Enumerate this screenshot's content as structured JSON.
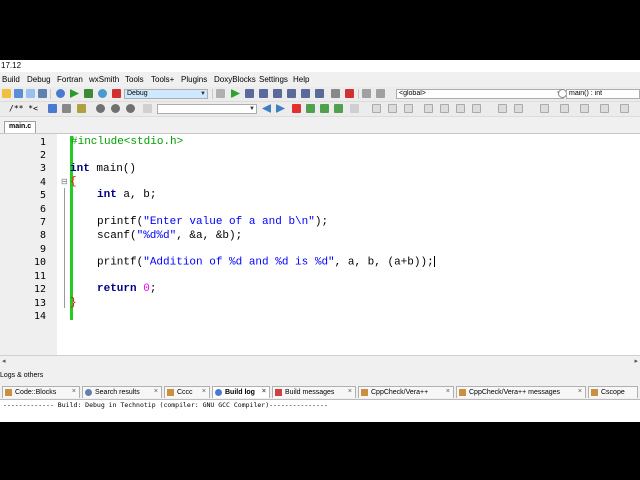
{
  "app": {
    "title_fragment": "17.12"
  },
  "menu": [
    "Build",
    "Debug",
    "Fortran",
    "wxSmith",
    "Tools",
    "Tools+",
    "Plugins",
    "DoxyBlocks",
    "Settings",
    "Help"
  ],
  "toolbar": {
    "build_target": "Debug",
    "scope_select": "<global>",
    "function_select": "main() : int",
    "doxy_comment": "/** *<"
  },
  "editor": {
    "tab_label": "main.c",
    "line_numbers": [
      "1",
      "2",
      "3",
      "4",
      "5",
      "6",
      "7",
      "8",
      "9",
      "10",
      "11",
      "12",
      "13",
      "14"
    ],
    "lines": {
      "l1": "#include<stdio.h>",
      "l3a": "int",
      "l3b": " main()",
      "l4": "{",
      "l5a": "int",
      "l5b": " a, b;",
      "l7a": "printf(",
      "l7b": "\"Enter value of a and b\\n\"",
      "l7c": ");",
      "l8a": "scanf(",
      "l8b": "\"%d%d\"",
      "l8c": ", &a, &b);",
      "l10a": "printf(",
      "l10b": "\"Addition of %d and %d is %d\"",
      "l10c": ", a, b, (a+b));",
      "l12a": "return",
      "l12b": " ",
      "l12c": "0",
      "l12d": ";",
      "l13": "}"
    }
  },
  "logs": {
    "title": "Logs & others",
    "tabs": [
      "Code::Blocks",
      "Search results",
      "Cccc",
      "Build log",
      "Build messages",
      "CppCheck/Vera++",
      "CppCheck/Vera++ messages",
      "Cscope"
    ],
    "active_tab": "Build log",
    "build_line": "------------- Build: Debug in Technotip (compiler: GNU GCC Compiler)---------------"
  },
  "colors": {
    "preprocessor": "#00a000",
    "keyword": "#00008b",
    "string": "#0000ff",
    "number": "#f000f0",
    "change_bar": "#22cc22"
  }
}
